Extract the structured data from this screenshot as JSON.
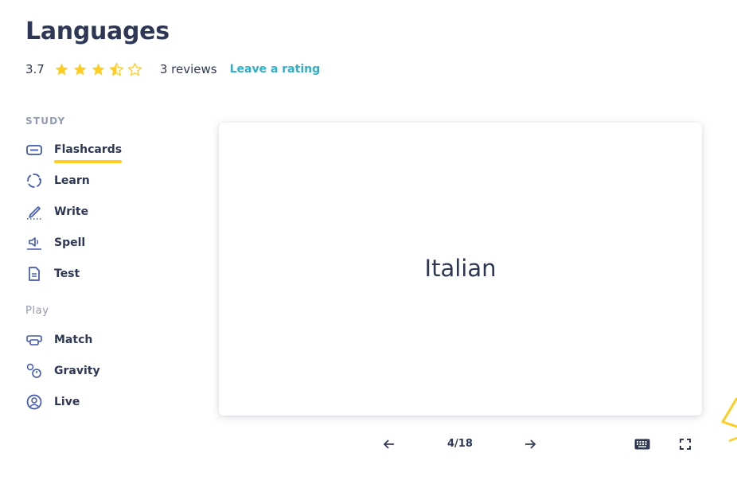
{
  "header": {
    "title": "Languages",
    "rating_value": "3.7",
    "stars": 3.5,
    "reviews": "3 reviews",
    "leave_rating": "Leave a rating",
    "star_color": "#ffcd1f"
  },
  "sidebar": {
    "study_label": "STUDY",
    "play_label": "Play",
    "study_items": [
      {
        "label": "Flashcards",
        "icon": "flashcards-icon",
        "active": true
      },
      {
        "label": "Learn",
        "icon": "learn-icon"
      },
      {
        "label": "Write",
        "icon": "write-icon"
      },
      {
        "label": "Spell",
        "icon": "spell-icon"
      },
      {
        "label": "Test",
        "icon": "test-icon"
      }
    ],
    "play_items": [
      {
        "label": "Match",
        "icon": "match-icon"
      },
      {
        "label": "Gravity",
        "icon": "gravity-icon"
      },
      {
        "label": "Live",
        "icon": "live-icon"
      }
    ],
    "icon_color": "#4257b2",
    "active_underline_color": "#ffcd1f"
  },
  "card": {
    "term": "Italian"
  },
  "controls": {
    "counter": "4/18",
    "prev_icon": "arrow-left-icon",
    "next_icon": "arrow-right-icon",
    "keyboard_icon": "keyboard-icon",
    "fullscreen_icon": "fullscreen-icon"
  }
}
